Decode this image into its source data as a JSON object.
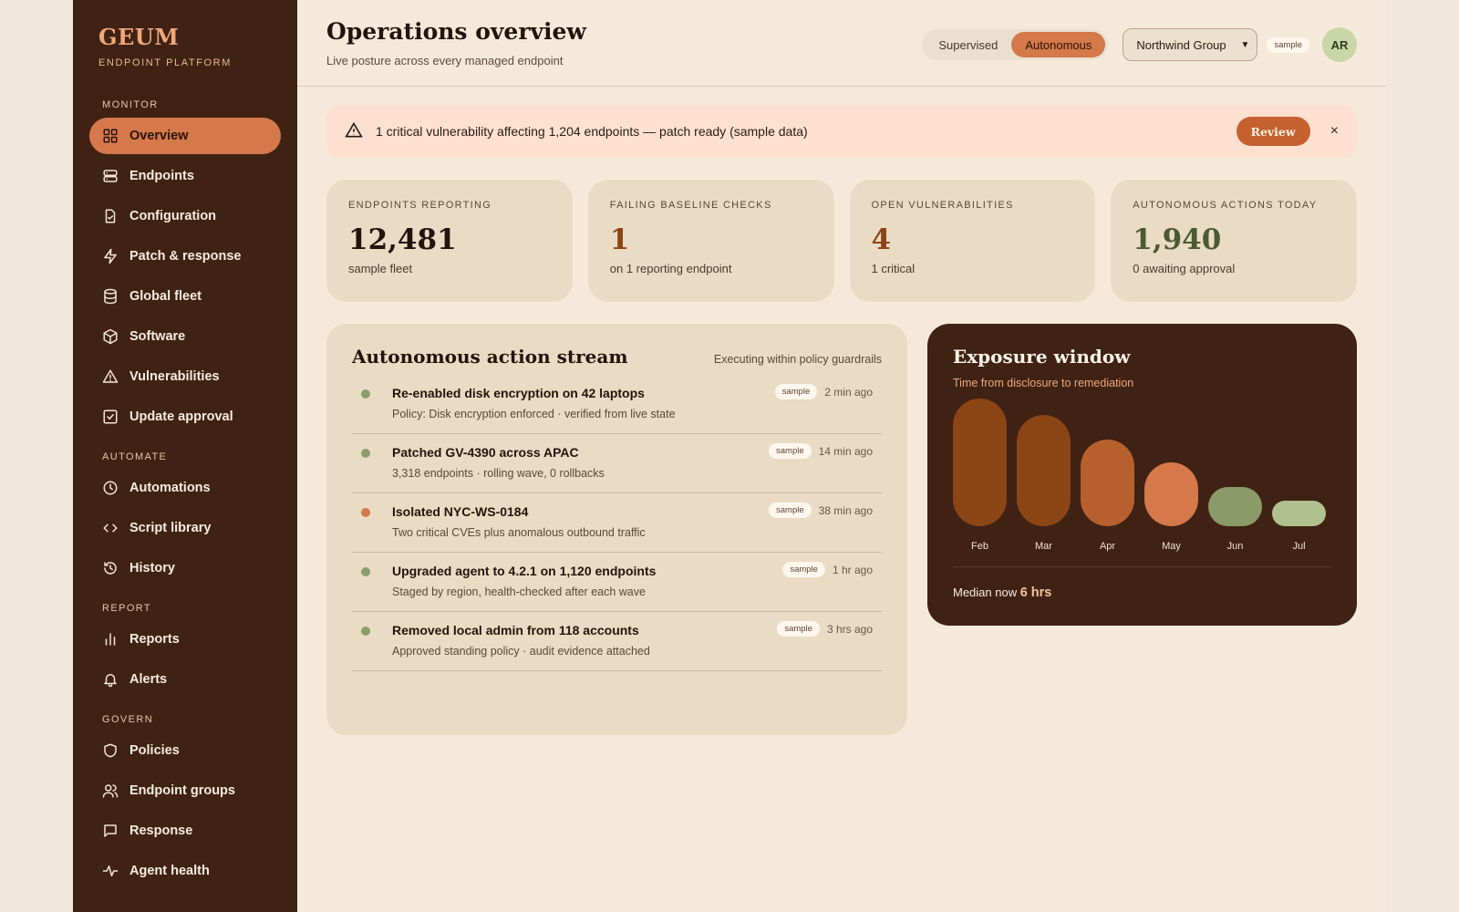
{
  "brand": {
    "name": "GEUM",
    "subtitle": "ENDPOINT PLATFORM"
  },
  "sidebar": {
    "sections": [
      {
        "label": "MONITOR",
        "items": [
          {
            "label": "Overview",
            "icon": "grid-icon",
            "active": true
          },
          {
            "label": "Endpoints",
            "icon": "server-icon"
          },
          {
            "label": "Configuration",
            "icon": "file-check-icon"
          },
          {
            "label": "Patch & response",
            "icon": "bolt-icon"
          },
          {
            "label": "Global fleet",
            "icon": "database-icon"
          },
          {
            "label": "Software",
            "icon": "package-icon"
          },
          {
            "label": "Vulnerabilities",
            "icon": "warning-icon"
          },
          {
            "label": "Update approval",
            "icon": "checkbox-icon"
          }
        ]
      },
      {
        "label": "AUTOMATE",
        "items": [
          {
            "label": "Automations",
            "icon": "clock-icon"
          },
          {
            "label": "Script library",
            "icon": "code-icon"
          },
          {
            "label": "History",
            "icon": "history-icon"
          }
        ]
      },
      {
        "label": "REPORT",
        "items": [
          {
            "label": "Reports",
            "icon": "bar-chart-icon"
          },
          {
            "label": "Alerts",
            "icon": "bell-icon"
          }
        ]
      },
      {
        "label": "GOVERN",
        "items": [
          {
            "label": "Policies",
            "icon": "shield-icon"
          },
          {
            "label": "Endpoint groups",
            "icon": "users-icon"
          },
          {
            "label": "Response",
            "icon": "message-icon"
          },
          {
            "label": "Agent health",
            "icon": "pulse-icon"
          }
        ]
      }
    ]
  },
  "header": {
    "title": "Operations overview",
    "subtitle": "Live posture across every managed endpoint",
    "modes": [
      "Supervised",
      "Autonomous"
    ],
    "active_mode": "Autonomous",
    "org": "Northwind Group",
    "sample_label": "sample",
    "avatar": "AR"
  },
  "alert": {
    "text": "1 critical vulnerability affecting 1,204 endpoints — patch ready (sample data)",
    "action": "Review",
    "close": "×"
  },
  "kpis": [
    {
      "label": "ENDPOINTS REPORTING",
      "value": "12,481",
      "sub": "sample fleet",
      "color": "#22140c"
    },
    {
      "label": "FAILING BASELINE CHECKS",
      "value": "1",
      "sub": "on 1 reporting endpoint",
      "color": "#8c4515"
    },
    {
      "label": "OPEN VULNERABILITIES",
      "value": "4",
      "sub": "1 critical",
      "color": "#8c4515"
    },
    {
      "label": "AUTONOMOUS ACTIONS TODAY",
      "value": "1,940",
      "sub": "0 awaiting approval",
      "color": "#4a5a32"
    }
  ],
  "stream": {
    "title": "Autonomous action stream",
    "note": "Executing within policy guardrails",
    "events": [
      {
        "title": "Re-enabled disk encryption on 42 laptops",
        "desc": "Policy: Disk encryption enforced · verified from live state",
        "badge": "sample",
        "time": "2 min ago",
        "status_color": "#8a9e6a"
      },
      {
        "title": "Patched GV-4390 across APAC",
        "desc": "3,318 endpoints · rolling wave, 0 rollbacks",
        "badge": "sample",
        "time": "14 min ago",
        "status_color": "#8a9e6a"
      },
      {
        "title": "Isolated NYC-WS-0184",
        "desc": "Two critical CVEs plus anomalous outbound traffic",
        "badge": "sample",
        "time": "38 min ago",
        "status_color": "#d5784a"
      },
      {
        "title": "Upgraded agent to 4.2.1 on 1,120 endpoints",
        "desc": "Staged by region, health-checked after each wave",
        "badge": "sample",
        "time": "1 hr ago",
        "status_color": "#8a9e6a"
      },
      {
        "title": "Removed local admin from 118 accounts",
        "desc": "Approved standing policy · audit evidence attached",
        "badge": "sample",
        "time": "3 hrs ago",
        "status_color": "#8a9e6a"
      }
    ]
  },
  "exposure": {
    "title": "Exposure window",
    "subtitle": "Time from disclosure to remediation",
    "median_label": "Median now",
    "median_value": "6 hrs"
  },
  "chart_data": {
    "type": "bar",
    "categories": [
      "Feb",
      "Mar",
      "Apr",
      "May",
      "Jun",
      "Jul"
    ],
    "values": [
      100,
      87,
      68,
      50,
      31,
      19
    ],
    "colors": [
      "#8c4515",
      "#8c4515",
      "#b8602d",
      "#d5784a",
      "#8a9a68",
      "#b0c08e"
    ],
    "title": "Exposure window",
    "ylim": [
      0,
      100
    ]
  }
}
